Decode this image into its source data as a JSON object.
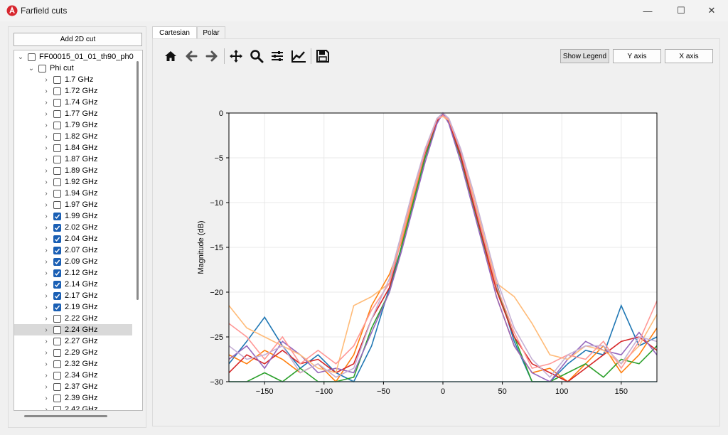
{
  "window": {
    "title": "Farfield cuts",
    "minimize": "—",
    "maximize": "☐",
    "close": "✕"
  },
  "left": {
    "add_button": "Add 2D cut",
    "root": {
      "label": "FF00015_01_01_th90_ph0"
    },
    "group": {
      "label": "Phi cut"
    },
    "items": [
      {
        "label": "1.7 GHz",
        "checked": false
      },
      {
        "label": "1.72 GHz",
        "checked": false
      },
      {
        "label": "1.74 GHz",
        "checked": false
      },
      {
        "label": "1.77 GHz",
        "checked": false
      },
      {
        "label": "1.79 GHz",
        "checked": false
      },
      {
        "label": "1.82 GHz",
        "checked": false
      },
      {
        "label": "1.84 GHz",
        "checked": false
      },
      {
        "label": "1.87 GHz",
        "checked": false
      },
      {
        "label": "1.89 GHz",
        "checked": false
      },
      {
        "label": "1.92 GHz",
        "checked": false
      },
      {
        "label": "1.94 GHz",
        "checked": false
      },
      {
        "label": "1.97 GHz",
        "checked": false
      },
      {
        "label": "1.99 GHz",
        "checked": true
      },
      {
        "label": "2.02 GHz",
        "checked": true
      },
      {
        "label": "2.04 GHz",
        "checked": true
      },
      {
        "label": "2.07 GHz",
        "checked": true
      },
      {
        "label": "2.09 GHz",
        "checked": true
      },
      {
        "label": "2.12 GHz",
        "checked": true
      },
      {
        "label": "2.14 GHz",
        "checked": true
      },
      {
        "label": "2.17 GHz",
        "checked": true
      },
      {
        "label": "2.19 GHz",
        "checked": true
      },
      {
        "label": "2.22 GHz",
        "checked": false
      },
      {
        "label": "2.24 GHz",
        "checked": false,
        "selected": true
      },
      {
        "label": "2.27 GHz",
        "checked": false
      },
      {
        "label": "2.29 GHz",
        "checked": false
      },
      {
        "label": "2.32 GHz",
        "checked": false
      },
      {
        "label": "2.34 GHz",
        "checked": false
      },
      {
        "label": "2.37 GHz",
        "checked": false
      },
      {
        "label": "2.39 GHz",
        "checked": false
      },
      {
        "label": "2.42 GHz",
        "checked": false
      }
    ]
  },
  "tabs": [
    {
      "label": "Cartesian",
      "active": true
    },
    {
      "label": "Polar",
      "active": false
    }
  ],
  "toolbar": {
    "icons": [
      "home-icon",
      "back-arrow-icon",
      "forward-arrow-icon",
      "pan-icon",
      "zoom-icon",
      "configure-subplots-icon",
      "edit-axis-icon",
      "save-icon"
    ],
    "show_legend": "Show Legend",
    "y_axis": "Y axis",
    "x_axis": "X axis"
  },
  "chart_data": {
    "type": "line",
    "title": "",
    "xlabel": "",
    "ylabel": "Magnitude (dB)",
    "xlim": [
      -180,
      180
    ],
    "ylim": [
      -30,
      0
    ],
    "xticks": [
      -150,
      -100,
      -50,
      0,
      50,
      100,
      150
    ],
    "yticks": [
      0,
      -5,
      -10,
      -15,
      -20,
      -25,
      -30
    ],
    "grid": true,
    "x": [
      -180,
      -165,
      -150,
      -135,
      -120,
      -105,
      -90,
      -75,
      -60,
      -45,
      -35,
      -25,
      -15,
      -5,
      0,
      5,
      15,
      25,
      35,
      45,
      60,
      75,
      90,
      105,
      120,
      135,
      150,
      165,
      180
    ],
    "series": [
      {
        "color": "#1f77b4",
        "values": [
          -28,
          -25.5,
          -22.8,
          -26,
          -28.5,
          -27,
          -29,
          -30,
          -26,
          -19.5,
          -15,
          -10,
          -5,
          -1,
          -0.2,
          -0.8,
          -4.5,
          -9.5,
          -14.5,
          -19,
          -25.5,
          -30,
          -30,
          -28,
          -26.5,
          -27,
          -21.5,
          -26,
          -25
        ]
      },
      {
        "color": "#ff7f0e",
        "values": [
          -27,
          -28,
          -26.5,
          -27.5,
          -29,
          -28,
          -30,
          -27,
          -21.5,
          -18,
          -14.5,
          -9.5,
          -4.5,
          -0.8,
          -0.3,
          -1,
          -5,
          -10,
          -15,
          -20.5,
          -26,
          -29,
          -28.5,
          -30,
          -28,
          -26,
          -29,
          -27,
          -24
        ]
      },
      {
        "color": "#2ca02c",
        "values": [
          -30,
          -30,
          -29,
          -30,
          -28.5,
          -30,
          -30,
          -29.5,
          -24,
          -20,
          -15,
          -10,
          -5,
          -1,
          -0.1,
          -1,
          -5,
          -10,
          -15,
          -19.5,
          -25,
          -30,
          -30,
          -29,
          -28,
          -29.5,
          -27.5,
          -28,
          -26
        ]
      },
      {
        "color": "#d62728",
        "values": [
          -29,
          -27,
          -28,
          -26.5,
          -28,
          -27.5,
          -29,
          -28,
          -23,
          -19.5,
          -14,
          -9,
          -4.5,
          -0.9,
          -0.2,
          -0.9,
          -4.8,
          -9.8,
          -14.8,
          -19.8,
          -25,
          -28,
          -29,
          -30,
          -28.5,
          -27,
          -25.5,
          -25,
          -26.5
        ]
      },
      {
        "color": "#9467bd",
        "values": [
          -27.5,
          -26,
          -28.5,
          -25.5,
          -27,
          -29,
          -28.5,
          -29,
          -24.5,
          -20,
          -15.5,
          -10.5,
          -5.5,
          -1.2,
          0,
          -1.2,
          -5.5,
          -10.5,
          -15.5,
          -20.5,
          -26,
          -29,
          -30,
          -27.5,
          -25.5,
          -26.5,
          -27,
          -24.5,
          -27
        ]
      },
      {
        "color": "#ffbb78",
        "values": [
          -21.5,
          -24,
          -25,
          -26,
          -27,
          -28.5,
          -29,
          -21.5,
          -20.5,
          -19,
          -14,
          -9,
          -4,
          -0.6,
          -0.4,
          -0.8,
          -4.2,
          -9,
          -14,
          -19,
          -20.5,
          -23.5,
          -27,
          -27.5,
          -26,
          -26.5,
          -28,
          -26,
          -22.5
        ]
      },
      {
        "color": "#ff9896",
        "values": [
          -23.5,
          -25,
          -27.5,
          -25,
          -28,
          -26.5,
          -28,
          -26,
          -22,
          -19,
          -14.2,
          -9.2,
          -4.3,
          -0.7,
          -0.3,
          -0.7,
          -4.3,
          -9.3,
          -14.3,
          -19.3,
          -24.5,
          -28.5,
          -28,
          -27,
          -27.5,
          -25.5,
          -28.5,
          -25.5,
          -21
        ]
      },
      {
        "color": "#c5b0d5",
        "values": [
          -26,
          -27.5,
          -27,
          -26,
          -29,
          -28,
          -29.5,
          -28.5,
          -23,
          -18.5,
          -13.5,
          -8.5,
          -4,
          -0.6,
          0,
          -0.6,
          -4,
          -8.5,
          -13.5,
          -18.5,
          -24,
          -27.5,
          -29.5,
          -27,
          -26,
          -26,
          -28,
          -25,
          -25.5
        ]
      },
      {
        "color": "#9edae5",
        "values": [
          -30,
          -30,
          -30,
          -30,
          -30,
          -30,
          -30,
          -30,
          -30,
          -30,
          -30,
          -30,
          -30,
          -30,
          -30,
          -30,
          -30,
          -30,
          -30,
          -30,
          -30,
          -30,
          -30,
          -30,
          -30,
          -30,
          -30,
          -30,
          -30
        ]
      }
    ]
  }
}
